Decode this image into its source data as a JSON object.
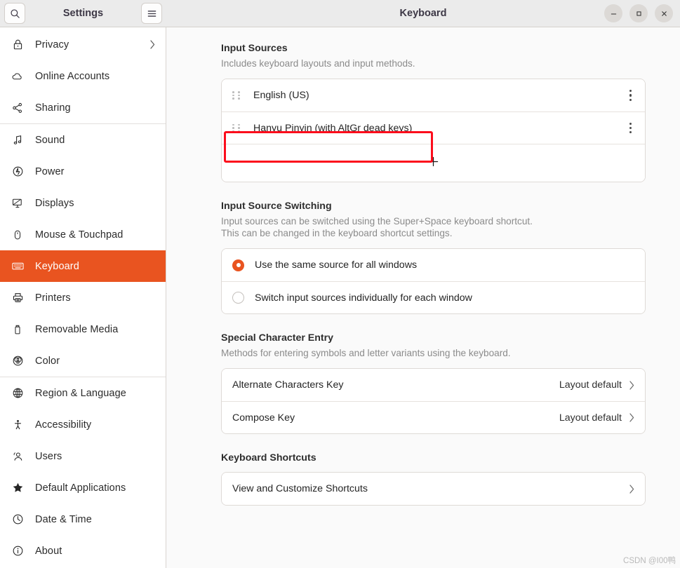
{
  "window": {
    "app_title": "Settings",
    "page_title": "Keyboard",
    "search_icon": "search-icon",
    "menu_icon": "hamburger-menu-icon",
    "controls": {
      "minimize": "minimize-icon",
      "maximize": "maximize-icon",
      "close": "close-icon"
    }
  },
  "sidebar": {
    "items": [
      {
        "label": "Privacy",
        "icon": "lock-icon",
        "active": false,
        "chevron": true
      },
      {
        "label": "Online Accounts",
        "icon": "cloud-icon",
        "active": false,
        "chevron": false
      },
      {
        "label": "Sharing",
        "icon": "share-icon",
        "active": false,
        "chevron": false
      },
      {
        "label": "Sound",
        "icon": "music-note-icon",
        "active": false,
        "chevron": false,
        "sep_before": true
      },
      {
        "label": "Power",
        "icon": "power-icon",
        "active": false,
        "chevron": false
      },
      {
        "label": "Displays",
        "icon": "monitor-icon",
        "active": false,
        "chevron": false
      },
      {
        "label": "Mouse & Touchpad",
        "icon": "mouse-icon",
        "active": false,
        "chevron": false
      },
      {
        "label": "Keyboard",
        "icon": "keyboard-icon",
        "active": true,
        "chevron": false
      },
      {
        "label": "Printers",
        "icon": "printer-icon",
        "active": false,
        "chevron": false
      },
      {
        "label": "Removable Media",
        "icon": "usb-drive-icon",
        "active": false,
        "chevron": false
      },
      {
        "label": "Color",
        "icon": "color-wheel-icon",
        "active": false,
        "chevron": false
      },
      {
        "label": "Region & Language",
        "icon": "globe-icon",
        "active": false,
        "chevron": false,
        "sep_before": true
      },
      {
        "label": "Accessibility",
        "icon": "accessibility-icon",
        "active": false,
        "chevron": false
      },
      {
        "label": "Users",
        "icon": "users-icon",
        "active": false,
        "chevron": false
      },
      {
        "label": "Default Applications",
        "icon": "star-icon",
        "active": false,
        "chevron": false
      },
      {
        "label": "Date & Time",
        "icon": "clock-icon",
        "active": false,
        "chevron": false
      },
      {
        "label": "About",
        "icon": "info-icon",
        "active": false,
        "chevron": false
      }
    ]
  },
  "main": {
    "input_sources": {
      "title": "Input Sources",
      "description": "Includes keyboard layouts and input methods.",
      "sources": [
        {
          "label": "English (US)"
        },
        {
          "label": "Hanyu Pinyin (with AltGr dead keys)",
          "highlighted": true
        }
      ],
      "add_button_label": "+"
    },
    "input_source_switching": {
      "title": "Input Source Switching",
      "description_line1": "Input sources can be switched using the Super+Space keyboard shortcut.",
      "description_line2": "This can be changed in the keyboard shortcut settings.",
      "options": [
        {
          "label": "Use the same source for all windows",
          "selected": true
        },
        {
          "label": "Switch input sources individually for each window",
          "selected": false
        }
      ]
    },
    "special_character_entry": {
      "title": "Special Character Entry",
      "description": "Methods for entering symbols and letter variants using the keyboard.",
      "rows": [
        {
          "label": "Alternate Characters Key",
          "value": "Layout default"
        },
        {
          "label": "Compose Key",
          "value": "Layout default"
        }
      ]
    },
    "keyboard_shortcuts": {
      "title": "Keyboard Shortcuts",
      "rows": [
        {
          "label": "View and Customize Shortcuts",
          "value": ""
        }
      ]
    }
  },
  "watermark": "CSDN @I00鸭",
  "colors": {
    "accent": "#e95420",
    "annotation": "#fc0d1c",
    "sidebar_bg": "#ffffff",
    "content_bg": "#fafafa",
    "titlebar_bg": "#ebebeb"
  }
}
